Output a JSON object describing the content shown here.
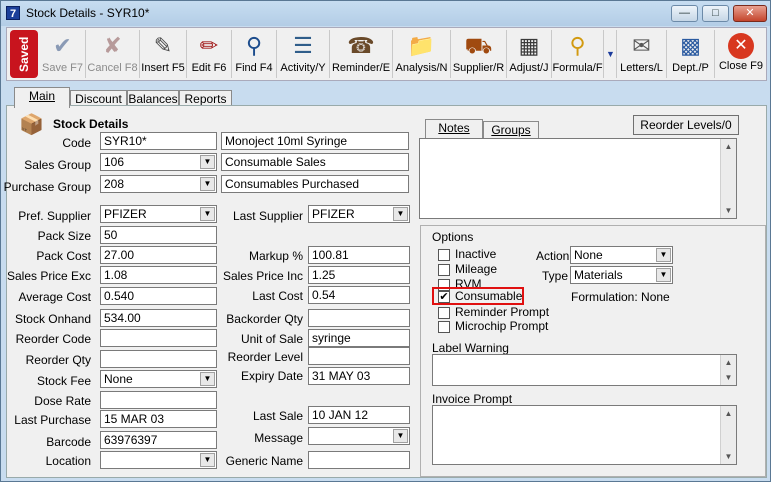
{
  "window": {
    "title": "Stock Details - SYR10*",
    "icon_text": "7"
  },
  "toolbar": {
    "saved": "Saved",
    "buttons": [
      {
        "label": "Save F7",
        "icon": "checkmark-icon"
      },
      {
        "label": "Cancel F8",
        "icon": "cancel-x-icon"
      },
      {
        "label": "Insert F5",
        "icon": "insert-icon"
      },
      {
        "label": "Edit F6",
        "icon": "edit-icon"
      },
      {
        "label": "Find F4",
        "icon": "magnifier-icon"
      },
      {
        "label": "Activity/Y",
        "icon": "activity-icon"
      },
      {
        "label": "Reminder/E",
        "icon": "reminder-icon"
      },
      {
        "label": "Analysis/N",
        "icon": "analysis-icon"
      },
      {
        "label": "Supplier/R",
        "icon": "truck-icon"
      },
      {
        "label": "Adjust/J",
        "icon": "adjust-icon"
      },
      {
        "label": "Formula/F",
        "icon": "formula-icon"
      },
      {
        "label": "Letters/L",
        "icon": "letters-icon"
      },
      {
        "label": "Dept./P",
        "icon": "dept-icon"
      },
      {
        "label": "Close F9",
        "icon": "close-icon"
      }
    ]
  },
  "tabs": [
    "Main",
    "Discount",
    "Balances",
    "Reports"
  ],
  "section_title": "Stock Details",
  "fields": {
    "code_label": "Code",
    "code": "SYR10*",
    "description": "Monoject 10ml Syringe",
    "sales_group_label": "Sales Group",
    "sales_group": "106",
    "sales_group_desc": "Consumable Sales",
    "purchase_group_label": "Purchase Group",
    "purchase_group": "208",
    "purchase_group_desc": "Consumables Purchased",
    "pref_supplier_label": "Pref. Supplier",
    "pref_supplier": "PFIZER",
    "last_supplier_label": "Last Supplier",
    "last_supplier": "PFIZER",
    "pack_size_label": "Pack Size",
    "pack_size": "50",
    "pack_cost_label": "Pack Cost",
    "pack_cost": "27.00",
    "markup_label": "Markup %",
    "markup": "100.81",
    "sales_price_exc_label": "Sales Price Exc",
    "sales_price_exc": "1.08",
    "sales_price_inc_label": "Sales Price Inc",
    "sales_price_inc": "1.25",
    "average_cost_label": "Average Cost",
    "average_cost": "0.540",
    "last_cost_label": "Last Cost",
    "last_cost": "0.54",
    "stock_onhand_label": "Stock Onhand",
    "stock_onhand": "534.00",
    "backorder_qty_label": "Backorder Qty",
    "backorder_qty": "",
    "reorder_code_label": "Reorder Code",
    "reorder_code": "",
    "unit_of_sale_label": "Unit of Sale",
    "unit_of_sale": "syringe",
    "reorder_qty_label": "Reorder Qty",
    "reorder_qty": "",
    "reorder_level_label": "Reorder Level",
    "reorder_level": "",
    "stock_fee_label": "Stock Fee",
    "stock_fee": "None",
    "expiry_date_label": "Expiry Date",
    "expiry_date": "31 MAY 03",
    "dose_rate_label": "Dose Rate",
    "dose_rate": "",
    "last_purchase_label": "Last Purchase",
    "last_purchase": "15 MAR 03",
    "last_sale_label": "Last Sale",
    "last_sale": "10 JAN 12",
    "barcode_label": "Barcode",
    "barcode": "63976397",
    "message_label": "Message",
    "message": "",
    "location_label": "Location",
    "location": "",
    "generic_name_label": "Generic Name",
    "generic_name": ""
  },
  "right": {
    "reorder_levels_button": "Reorder Levels/0",
    "notes_tabs": [
      "Notes",
      "Groups"
    ],
    "options_title": "Options",
    "checkboxes": [
      {
        "label": "Inactive",
        "checked": false
      },
      {
        "label": "Mileage",
        "checked": false
      },
      {
        "label": "RVM",
        "checked": false
      },
      {
        "label": "Consumable",
        "checked": true
      },
      {
        "label": "Reminder Prompt",
        "checked": false
      },
      {
        "label": "Microchip Prompt",
        "checked": false
      }
    ],
    "action_label": "Action",
    "action": "None",
    "type_label": "Type",
    "type": "Materials",
    "formulation": "Formulation: None",
    "label_warning_title": "Label Warning",
    "invoice_prompt_title": "Invoice Prompt"
  },
  "colors": {
    "saved_badge": "#c8141e",
    "highlight": "#e01010",
    "title_bar": "#c7ddf1"
  }
}
